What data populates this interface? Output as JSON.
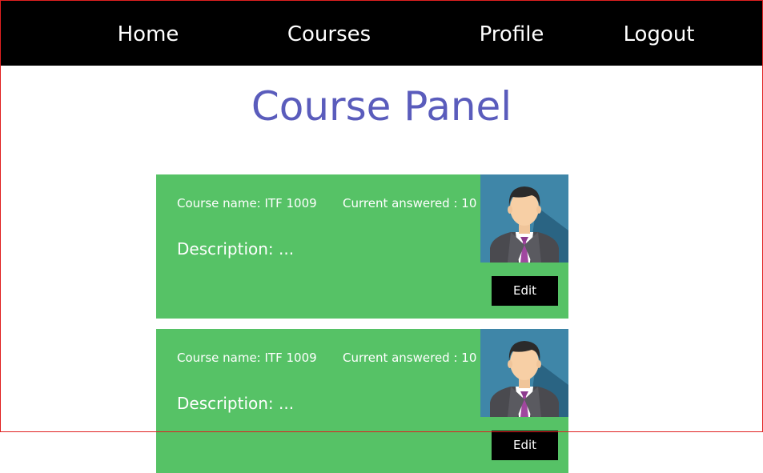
{
  "nav": {
    "items": [
      {
        "label": "Home"
      },
      {
        "label": "Courses"
      },
      {
        "label": "Profile"
      },
      {
        "label": "Logout"
      }
    ]
  },
  "page": {
    "title": "Course Panel"
  },
  "courses": [
    {
      "name_text": "Course name: ITF 1009",
      "answered_text": "Current answered : 10",
      "description_text": "Description: ...",
      "edit_label": "Edit",
      "avatar_icon": "person-avatar-icon"
    },
    {
      "name_text": "Course name: ITF 1009",
      "answered_text": "Current answered : 10",
      "description_text": "Description: ...",
      "edit_label": "Edit",
      "avatar_icon": "person-avatar-icon"
    }
  ],
  "colors": {
    "nav_bg": "#000000",
    "title": "#5a5cbc",
    "card_bg": "#56c266",
    "avatar_bg": "#3f86a8",
    "border": "#e02020"
  }
}
